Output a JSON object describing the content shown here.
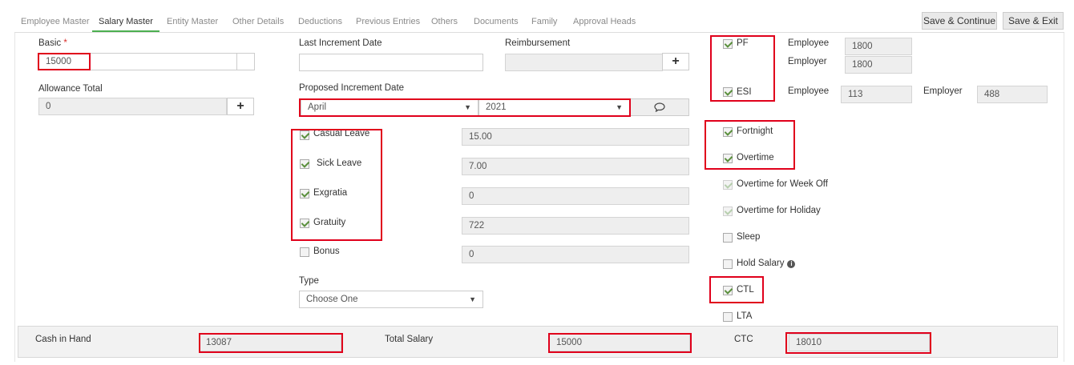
{
  "tabs": [
    {
      "label": "Employee Master"
    },
    {
      "label": "Salary Master"
    },
    {
      "label": "Entity Master"
    },
    {
      "label": "Other Details"
    },
    {
      "label": "Deductions"
    },
    {
      "label": "Previous Entries"
    },
    {
      "label": "Others"
    },
    {
      "label": "Documents"
    },
    {
      "label": "Family"
    },
    {
      "label": "Approval Heads"
    }
  ],
  "active_tab": "Salary Master",
  "actions": {
    "save_continue": "Save & Continue",
    "save_exit": "Save & Exit"
  },
  "basic": {
    "label": "Basic",
    "required_mark": "*",
    "value": "15000"
  },
  "allowance_total": {
    "label": "Allowance Total",
    "value": "0"
  },
  "last_increment_date": {
    "label": "Last Increment Date",
    "value": ""
  },
  "reimbursement": {
    "label": "Reimbursement",
    "value": ""
  },
  "proposed_increment_date": {
    "label": "Proposed Increment Date",
    "month": "April",
    "year": "2021"
  },
  "leaves": [
    {
      "label": "Casual Leave",
      "checked": true,
      "value": "15.00"
    },
    {
      "label": "Sick Leave",
      "checked": true,
      "value": "7.00"
    },
    {
      "label": "Exgratia",
      "checked": true,
      "value": "0"
    },
    {
      "label": "Gratuity",
      "checked": true,
      "value": "722"
    },
    {
      "label": "Bonus",
      "checked": false,
      "value": "0"
    }
  ],
  "type": {
    "label": "Type",
    "value": "Choose One"
  },
  "pf": {
    "label": "PF",
    "checked": true,
    "employee_label": "Employee",
    "employee_value": "1800",
    "employer_label": "Employer",
    "employer_value": "1800"
  },
  "esi": {
    "label": "ESI",
    "checked": true,
    "employee_label": "Employee",
    "employee_value": "113",
    "employer_label": "Employer",
    "employer_value": "488"
  },
  "options": [
    {
      "label": "Fortnight",
      "checked": true,
      "faint": false
    },
    {
      "label": "Overtime",
      "checked": true,
      "faint": false
    },
    {
      "label": "Overtime for Week Off",
      "checked": true,
      "faint": true
    },
    {
      "label": "Overtime for Holiday",
      "checked": true,
      "faint": true
    },
    {
      "label": "Sleep",
      "checked": false,
      "faint": false
    },
    {
      "label": "Hold Salary",
      "checked": false,
      "faint": false
    },
    {
      "label": "CTL",
      "checked": true,
      "faint": false
    },
    {
      "label": "LTA",
      "checked": false,
      "faint": false
    }
  ],
  "footer": {
    "cash_in_hand_label": "Cash in Hand",
    "cash_in_hand_value": "13087",
    "total_salary_label": "Total Salary",
    "total_salary_value": "15000",
    "ctc_label": "CTC",
    "ctc_value": "18010"
  },
  "colors": {
    "accent_tab": "#4caf50",
    "highlight": "#e0001b",
    "checkbox_check": "#5a8f3c"
  },
  "icons": {
    "add": "plus-icon",
    "chat": "comment-icon",
    "info": "info-circle-icon",
    "caret": "chevron-down-icon"
  }
}
